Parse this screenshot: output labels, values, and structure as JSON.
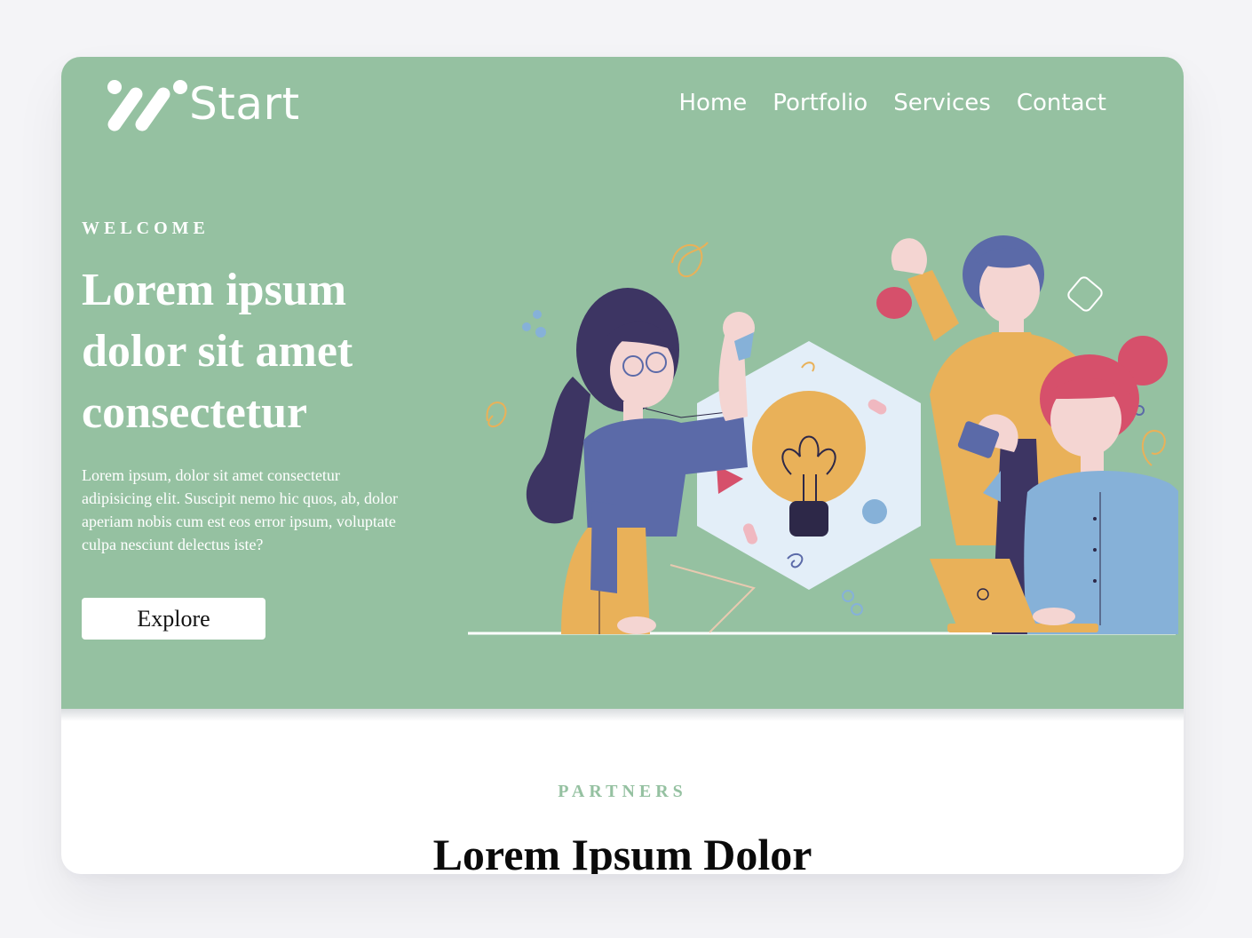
{
  "brand": {
    "name": "Start",
    "logo_icon": "start-logo-icon"
  },
  "nav": {
    "items": [
      "Home",
      "Portfolio",
      "Services",
      "Contact"
    ]
  },
  "hero": {
    "eyebrow": "WELCOME",
    "title_lines": [
      "Lorem ipsum",
      "dolor sit amet",
      "consectetur"
    ],
    "text": "Lorem ipsum, dolor sit amet consectetur adipisicing elit. Suscipit nemo hic quos, ab, dolor aperiam nobis cum est eos error ipsum, voluptate culpa nesciunt delectus iste?",
    "button_label": "Explore",
    "illustration_icon": "team-lightbulb-illustration"
  },
  "partners": {
    "label": "PARTNERS",
    "title": "Lorem Ipsum Dolor"
  },
  "colors": {
    "hero_bg": "#95c1a1",
    "accent_green": "#95c1a1",
    "page_bg": "#f4f4f7",
    "button_bg": "#ffffff",
    "yellow": "#e9b159",
    "blue": "#5b6aa8",
    "light_blue": "#86b1d8",
    "pink": "#d6506b"
  }
}
